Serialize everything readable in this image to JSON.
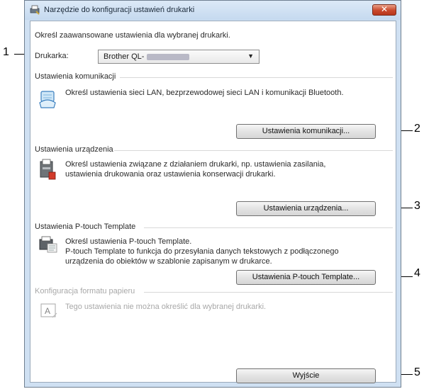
{
  "window": {
    "title": "Narzędzie do konfiguracji ustawień drukarki"
  },
  "intro": "Określ zaawansowane ustawienia dla wybranej drukarki.",
  "printer": {
    "label": "Drukarka:",
    "value": "Brother QL-"
  },
  "sections": {
    "communication": {
      "title": "Ustawienia komunikacji",
      "description": "Określ ustawienia sieci LAN, bezprzewodowej sieci LAN i komunikacji Bluetooth.",
      "button": "Ustawienia komunikacji..."
    },
    "device": {
      "title": "Ustawienia urządzenia",
      "description_line1": "Określ ustawienia związane z działaniem drukarki, np. ustawienia zasilania,",
      "description_line2": "ustawienia drukowania oraz ustawienia konserwacji drukarki.",
      "button": "Ustawienia urządzenia..."
    },
    "ptouch": {
      "title": "Ustawienia P-touch Template",
      "description_line1": "Określ ustawienia P-touch Template.",
      "description_line2": "P-touch Template to funkcja do przesyłania danych tekstowych z podłączonego",
      "description_line3": "urządzenia do obiektów w szablonie zapisanym w drukarce.",
      "button": "Ustawienia P-touch Template..."
    },
    "paper": {
      "title": "Konfiguracja formatu papieru",
      "description": "Tego ustawienia nie można określić dla wybranej drukarki."
    }
  },
  "exit_button": "Wyjście",
  "callouts": [
    "1",
    "2",
    "3",
    "4",
    "5"
  ]
}
